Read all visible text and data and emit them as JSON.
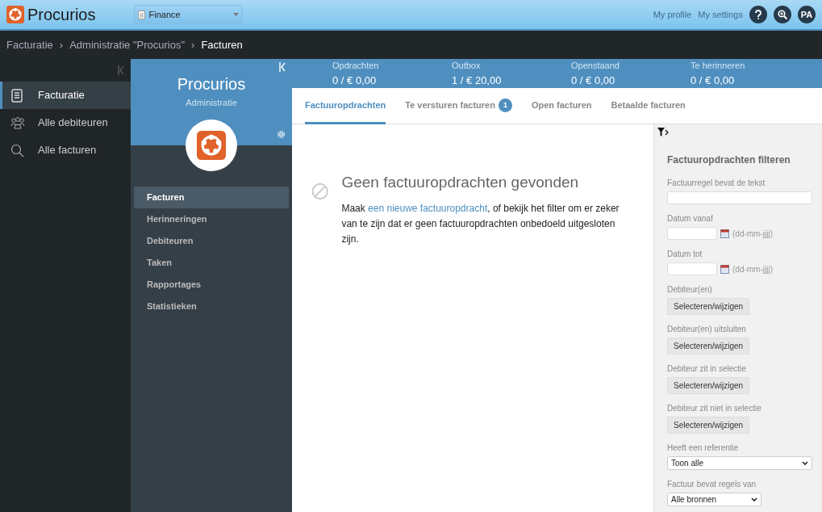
{
  "header": {
    "brand": "Procurios",
    "workspace": "Finance",
    "links": [
      "My profile",
      "My settings"
    ],
    "avatar": "PA"
  },
  "breadcrumb": [
    {
      "label": "Facturatie",
      "current": false
    },
    {
      "separator": "›",
      "label": "Administratie \"Procurios\"",
      "current": false
    },
    {
      "separator": "›",
      "label": "Facturen",
      "current": true
    }
  ],
  "sidebar": {
    "items": [
      {
        "label": "Facturatie",
        "selected": true
      },
      {
        "label": "Alle debiteuren",
        "selected": false
      },
      {
        "label": "Alle facturen",
        "selected": false
      }
    ]
  },
  "admin_panel": {
    "title": "Procurios",
    "subtitle": "Administratie",
    "items": [
      {
        "label": "Facturen",
        "selected": true
      },
      {
        "label": "Herinneringen",
        "selected": false
      },
      {
        "label": "Debiteuren",
        "selected": false
      },
      {
        "label": "Taken",
        "selected": false
      },
      {
        "label": "Rapportages",
        "selected": false
      },
      {
        "label": "Statistieken",
        "selected": false
      }
    ]
  },
  "stats": [
    {
      "label": "Opdrachten",
      "value": "0 / € 0,00"
    },
    {
      "label": "Outbox",
      "value": "1 / € 20,00"
    },
    {
      "label": "Openstaand",
      "value": "0 / € 0,00"
    },
    {
      "label": "Te herinneren",
      "value": "0 / € 0,00"
    }
  ],
  "tabs": [
    {
      "label": "Factuuropdrachten",
      "selected": true
    },
    {
      "label": "Te versturen facturen",
      "badge": "1",
      "selected": false
    },
    {
      "label": "Open facturen",
      "selected": false
    },
    {
      "label": "Betaalde facturen",
      "selected": false
    }
  ],
  "empty_state": {
    "title": "Geen factuuropdrachten gevonden",
    "before": "Maak ",
    "link": "een nieuwe factuuropdracht",
    "after": ", of bekijk het filter om er zeker van te zijn dat er geen factuuropdrachten onbedoeld uitgesloten zijn."
  },
  "filter": {
    "title": "Factuuropdrachten filteren",
    "fields": [
      {
        "kind": "text",
        "label": "Factuurregel bevat de tekst"
      },
      {
        "kind": "date",
        "label": "Datum vanaf",
        "hint": "(dd-mm-jjjj)"
      },
      {
        "kind": "date",
        "label": "Datum tot",
        "hint": "(dd-mm-jjjj)"
      },
      {
        "kind": "picker",
        "label": "Debiteur(en)",
        "button": "Selecteren/wijzigen"
      },
      {
        "kind": "picker",
        "label": "Debiteur(en) uitsluiten",
        "button": "Selecteren/wijzigen"
      },
      {
        "kind": "picker",
        "label": "Debiteur zit in selectie",
        "button": "Selecteren/wijzigen"
      },
      {
        "kind": "picker",
        "label": "Debiteur zit niet in selectie",
        "button": "Selecteren/wijzigen"
      },
      {
        "kind": "select",
        "label": "Heeft een referentie",
        "value": "Toon alle"
      },
      {
        "kind": "dropdown",
        "label": "Factuur bevat regels van",
        "value": "Alle bronnen"
      }
    ]
  }
}
